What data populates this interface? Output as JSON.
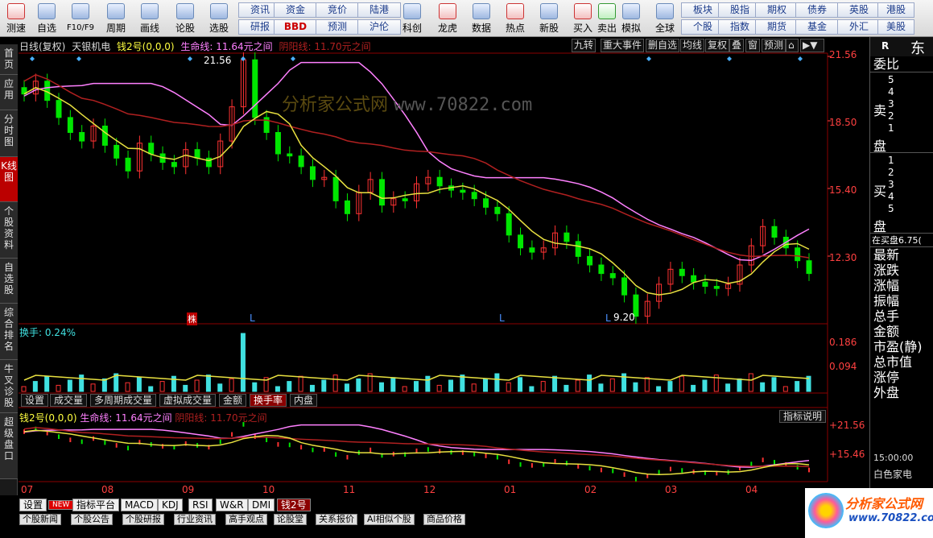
{
  "toolbar": {
    "left_buttons": [
      "测速",
      "自选",
      "F10/F9",
      "周期",
      "画线",
      "论股",
      "选股"
    ],
    "grid_row1": [
      "资讯",
      "资金",
      "竞价",
      "陆港"
    ],
    "grid_row2": [
      "研报",
      "BBD",
      "预测",
      "沪伦"
    ],
    "mid_buttons": [
      "科创",
      "龙虎",
      "数据",
      "热点",
      "新股"
    ],
    "trade_buttons": [
      "买入",
      "卖出",
      "模拟"
    ],
    "global_button": "全球",
    "right_row1": [
      "板块",
      "股指",
      "期权",
      "债券",
      "英股",
      "港股"
    ],
    "right_row2": [
      "个股",
      "指数",
      "期货",
      "基金",
      "外汇",
      "美股"
    ]
  },
  "left_nav": [
    "首页",
    "应用",
    "分时图",
    "K线图",
    "个股资料",
    "自选股",
    "综合排名",
    "牛叉诊股",
    "超级盘口"
  ],
  "header": {
    "period": "日线(复权)",
    "stock": "天银机电",
    "indicator": "钱2号(0,0,0)",
    "life_line": "生命线: 11.64元之间",
    "yin_yang": "阴阳线: 11.70元之间"
  },
  "chart_tabs": [
    "九转",
    "重大事件",
    "删自选",
    "均线",
    "复权",
    "叠",
    "窗",
    "预测"
  ],
  "price_axis": [
    "21.56",
    "18.50",
    "15.40",
    "12.30"
  ],
  "vol_axis": [
    "0.186",
    "0.094"
  ],
  "ind_axis": [
    "+21.56",
    "+15.46"
  ],
  "x_labels": [
    "07",
    "08",
    "09",
    "10",
    "11",
    "12",
    "01",
    "02",
    "03",
    "04"
  ],
  "annotations": {
    "high": "21.56",
    "low": "9.20",
    "badge": "株",
    "l_marks": [
      "L",
      "L",
      "L"
    ]
  },
  "volume_label": "换手: 0.24%",
  "panel_tabs": [
    "设置",
    "成交量",
    "多周期成交量",
    "虚拟成交量",
    "金额",
    "换手率",
    "内盘"
  ],
  "indicator_header": {
    "name": "钱2号(0,0,0)",
    "life": "生命线: 11.64元之间",
    "yin": "阴阳线: 11.70元之间",
    "explain": "指标说明"
  },
  "bottom_tabs": [
    "设置",
    "NEW",
    "指标平台",
    "MACD",
    "KDJ",
    "RSI",
    "W&R",
    "DMI",
    "钱2号"
  ],
  "bottom_tabs2": [
    "个股新闻",
    "个股公告",
    "个股研报",
    "行业资讯",
    "高手观点",
    "论股堂",
    "关系报价",
    "AI相似个股",
    "商品价格"
  ],
  "right_panel": {
    "title": "R",
    "name": "东",
    "commission": "委比",
    "sell": "卖盘",
    "sell_levels": [
      "5",
      "4",
      "3",
      "2",
      "1"
    ],
    "buy": "买盘",
    "buy_levels": [
      "1",
      "2",
      "3",
      "4",
      "5"
    ],
    "in_buy": "在买盘6.75(",
    "fields": [
      "最新",
      "涨跌",
      "涨幅",
      "振幅",
      "总手",
      "金额",
      "市盈(静)",
      "总市值",
      "涨停",
      "外盘"
    ],
    "time": "15:00:00",
    "sector": "白色家电"
  },
  "watermark": {
    "brand": "分析家公式网",
    "url": "www.70822.com",
    "logo_text": "分析家公式网",
    "logo_url": "www.70822.com"
  },
  "colors": {
    "up": "#ff3232",
    "down": "#00e600",
    "pink": "#ff80ff",
    "maroon": "#b02020",
    "yellow": "#e8e040",
    "cyan": "#40e0e0",
    "blue": "#4a80e0"
  },
  "chart_data": {
    "type": "candlestick",
    "price_range": [
      9.2,
      21.56
    ],
    "closes": [
      19.8,
      20.4,
      19.5,
      18.7,
      18.0,
      17.6,
      18.3,
      17.4,
      16.8,
      16.2,
      17.5,
      17.0,
      16.6,
      16.4,
      17.2,
      16.8,
      16.4,
      17.6,
      19.2,
      21.4,
      18.7,
      18.0,
      17.0,
      16.9,
      16.4,
      15.8,
      15.9,
      14.8,
      14.2,
      15.2,
      15.8,
      14.6,
      14.9,
      14.8,
      15.6,
      15.9,
      15.5,
      15.3,
      15.2,
      14.9,
      14.5,
      14.2,
      13.2,
      12.6,
      12.4,
      12.6,
      13.3,
      12.9,
      12.2,
      11.8,
      11.4,
      11.2,
      10.4,
      9.4,
      10.1,
      10.9,
      11.6,
      11.3,
      11.0,
      10.8,
      10.7,
      10.9,
      11.8,
      12.7,
      13.6,
      13.1,
      12.6,
      12.0,
      11.4
    ],
    "volume_range": [
      0,
      0.186
    ]
  }
}
